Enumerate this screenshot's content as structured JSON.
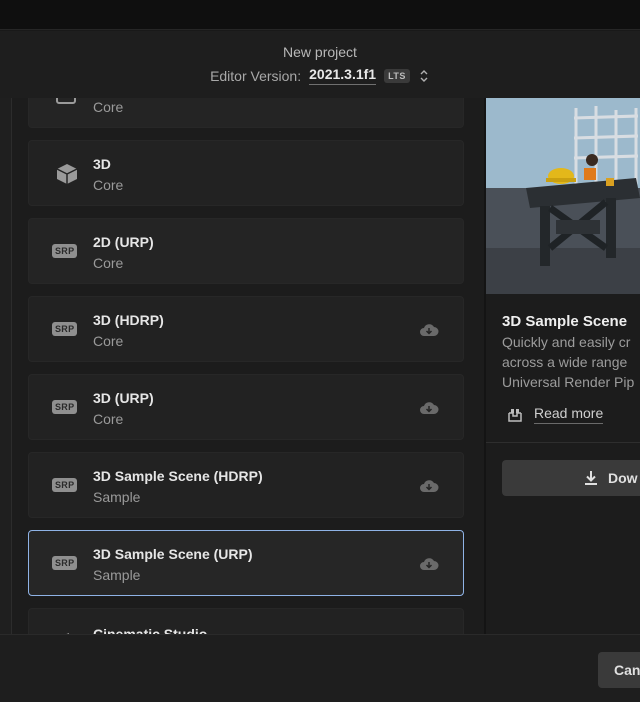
{
  "header": {
    "title": "New project",
    "editor_version_label": "Editor Version:",
    "editor_version_value": "2021.3.1f1",
    "lts_badge": "LTS"
  },
  "templates": [
    {
      "name": "",
      "category": "Core",
      "icon": "sprite-icon",
      "partial": true
    },
    {
      "name": "3D",
      "category": "Core",
      "icon": "cube-icon"
    },
    {
      "name": "2D (URP)",
      "category": "Core",
      "icon": "srp-icon",
      "badge": "SRP"
    },
    {
      "name": "3D (HDRP)",
      "category": "Core",
      "icon": "srp-icon",
      "badge": "SRP",
      "download": true
    },
    {
      "name": "3D (URP)",
      "category": "Core",
      "icon": "srp-icon",
      "badge": "SRP",
      "download": true
    },
    {
      "name": "3D Sample Scene (HDRP)",
      "category": "Sample",
      "icon": "srp-icon",
      "badge": "SRP",
      "download": true
    },
    {
      "name": "3D Sample Scene (URP)",
      "category": "Sample",
      "icon": "srp-icon",
      "badge": "SRP",
      "download": true,
      "selected": true
    },
    {
      "name": "Cinematic Studio",
      "category": "",
      "icon": "film-icon",
      "partial": true
    }
  ],
  "details": {
    "title": "3D Sample Scene",
    "description_lines": [
      "Quickly and easily cr",
      "across a wide range",
      "Universal Render Pip"
    ],
    "read_more": "Read more",
    "download_button": "Dow"
  },
  "footer": {
    "cancel_button": "Can"
  },
  "colors": {
    "selection_border": "#8fb3e6",
    "background": "#191919",
    "card": "#242424"
  }
}
